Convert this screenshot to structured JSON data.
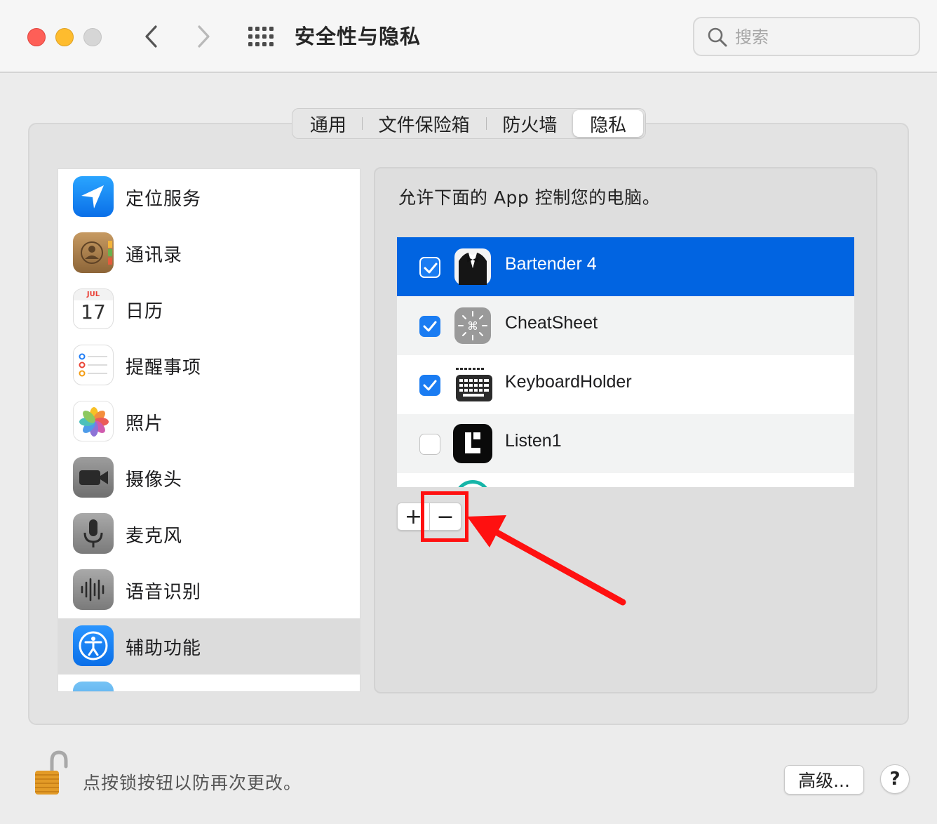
{
  "window": {
    "title": "安全性与隐私",
    "search_placeholder": "搜索"
  },
  "tabs": [
    {
      "label": "通用",
      "active": false
    },
    {
      "label": "文件保险箱",
      "active": false
    },
    {
      "label": "防火墙",
      "active": false
    },
    {
      "label": "隐私",
      "active": true
    }
  ],
  "sidebar": {
    "items": [
      {
        "label": "定位服务",
        "icon": "location-arrow-icon"
      },
      {
        "label": "通讯录",
        "icon": "contacts-icon"
      },
      {
        "label": "日历",
        "icon": "calendar-icon",
        "month": "JUL",
        "day": "17"
      },
      {
        "label": "提醒事项",
        "icon": "reminders-icon"
      },
      {
        "label": "照片",
        "icon": "photos-icon"
      },
      {
        "label": "摄像头",
        "icon": "camera-icon"
      },
      {
        "label": "麦克风",
        "icon": "microphone-icon"
      },
      {
        "label": "语音识别",
        "icon": "speech-recognition-icon"
      },
      {
        "label": "辅助功能",
        "icon": "accessibility-icon",
        "selected": true
      }
    ]
  },
  "panel": {
    "description": "允许下面的 App 控制您的电脑。",
    "apps": [
      {
        "name": "Bartender 4",
        "checked": true,
        "selected": true,
        "icon": "bartender-icon"
      },
      {
        "name": "CheatSheet",
        "checked": true,
        "selected": false,
        "icon": "cheatsheet-icon"
      },
      {
        "name": "KeyboardHolder",
        "checked": true,
        "selected": false,
        "icon": "keyboard-icon"
      },
      {
        "name": "Listen1",
        "checked": false,
        "selected": false,
        "icon": "listen1-icon"
      }
    ],
    "add_label": "+",
    "remove_label": "−"
  },
  "footer": {
    "lock_text": "点按锁按钮以防再次更改。",
    "advanced_label": "高级...",
    "help_label": "?"
  },
  "colors": {
    "selection_blue": "#0164e1",
    "checkbox_blue": "#1a7cf2",
    "annotation_red": "#ff1010"
  }
}
